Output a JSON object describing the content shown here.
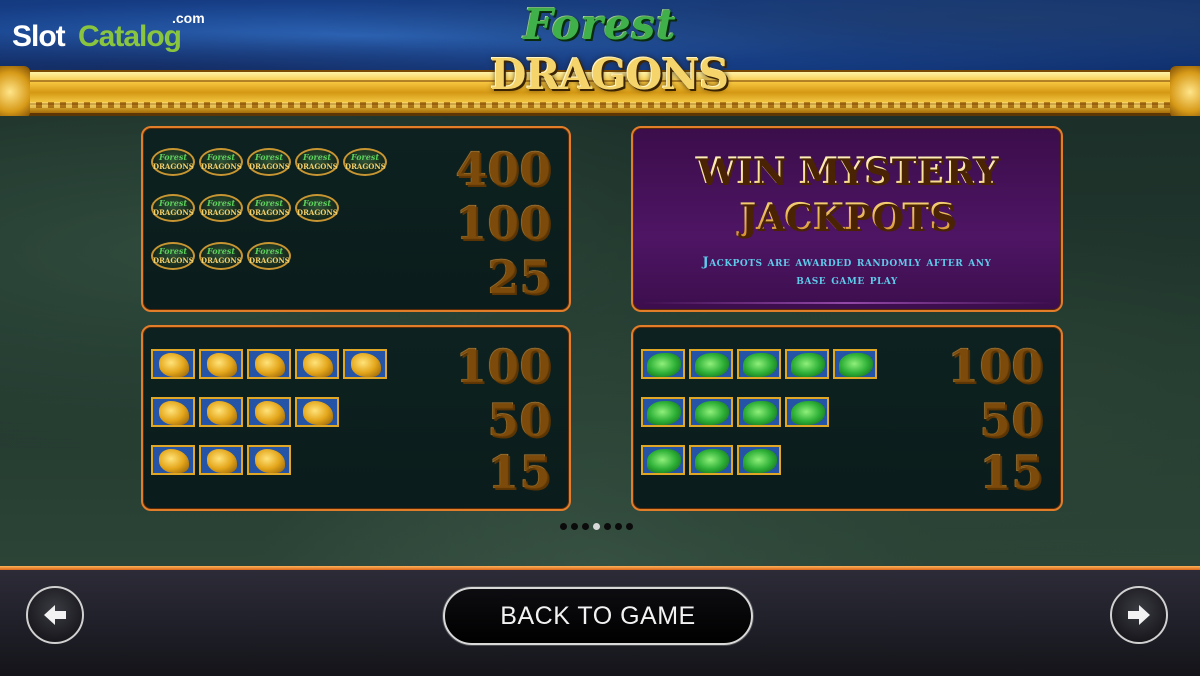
{
  "watermark": {
    "part1": "Slot",
    "part2": "Catalog",
    "part3": ".com"
  },
  "logo": {
    "line1": "Forest",
    "line2": "DRAGONS"
  },
  "paytable": {
    "logo_symbol": {
      "payouts": [
        "400",
        "100",
        "25"
      ],
      "counts": [
        5,
        4,
        3
      ]
    },
    "gold_dragon": {
      "payouts": [
        "100",
        "50",
        "15"
      ],
      "counts": [
        5,
        4,
        3
      ]
    },
    "green_dragon": {
      "payouts": [
        "100",
        "50",
        "15"
      ],
      "counts": [
        5,
        4,
        3
      ]
    }
  },
  "jackpot": {
    "title_line1": "WIN MYSTERY",
    "title_line2": "JACKPOTS",
    "subtitle_line1": "Jackpots are awarded randomly after any",
    "subtitle_line2": "base game play"
  },
  "pagination": {
    "total": 6,
    "active_index": 3
  },
  "buttons": {
    "back": "BACK TO GAME"
  },
  "icons": {
    "prev": "arrow-left-icon",
    "next": "arrow-right-icon"
  },
  "colors": {
    "panel_border": "#e27d2a",
    "jackpot_bg": "#4e1564",
    "jackpot_text": "#5fc9ea",
    "accent_orange": "#d9661a"
  }
}
